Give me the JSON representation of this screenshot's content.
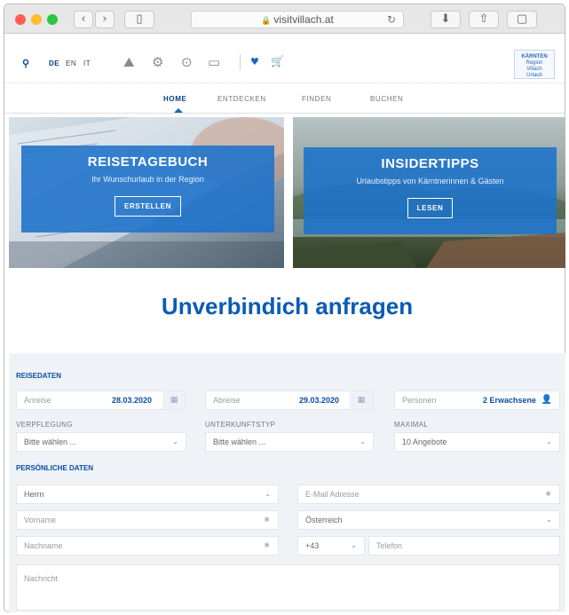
{
  "browser": {
    "url": "visitvillach.at",
    "colors": {
      "close": "#ff5f57",
      "minimize": "#febc2e",
      "zoom": "#28c840"
    }
  },
  "header": {
    "langs": [
      "DE",
      "EN",
      "IT"
    ],
    "logo_lines": [
      "KÄRNTEN",
      "Region",
      "Villach",
      "—",
      "Urlaub"
    ]
  },
  "nav": {
    "items": [
      "HOME",
      "ENTDECKEN",
      "FINDEN",
      "BUCHEN"
    ]
  },
  "teasers": [
    {
      "title": "REISETAGEBUCH",
      "subtitle": "Ihr Wunschurlaub in der Region",
      "button": "ERSTELLEN"
    },
    {
      "title": "INSIDERTIPPS",
      "subtitle": "Urlaubstipps von Kärntnerinnen & Gästen",
      "button": "LESEN"
    }
  ],
  "heading": "Unverbindich anfragen",
  "form": {
    "reisedaten_title": "REISEDATEN",
    "anreise": {
      "label": "Anreise",
      "value": "28.03.2020"
    },
    "abreise": {
      "label": "Abreise",
      "value": "29.03.2020"
    },
    "personen": {
      "label": "Personen",
      "value": "2 Erwachsene"
    },
    "verpflegung": {
      "label": "VERPFLEGUNG",
      "value": "Bitte wählen ..."
    },
    "unterkunftstyp": {
      "label": "UNTERKUNFTSTYP",
      "value": "Bitte wählen ..."
    },
    "maximal": {
      "label": "MAXIMAL",
      "value": "10 Angebote"
    },
    "personal_title": "PERSÖNLICHE DATEN",
    "anrede": "Herrn",
    "email_placeholder": "E-Mail Adresse",
    "vorname_placeholder": "Vorname",
    "land": "Österreich",
    "nachname_placeholder": "Nachname",
    "vorwahl": "+43",
    "telefon_placeholder": "Telefon",
    "nachricht_placeholder": "Nachricht"
  },
  "accent_color": "#0a5bb5"
}
